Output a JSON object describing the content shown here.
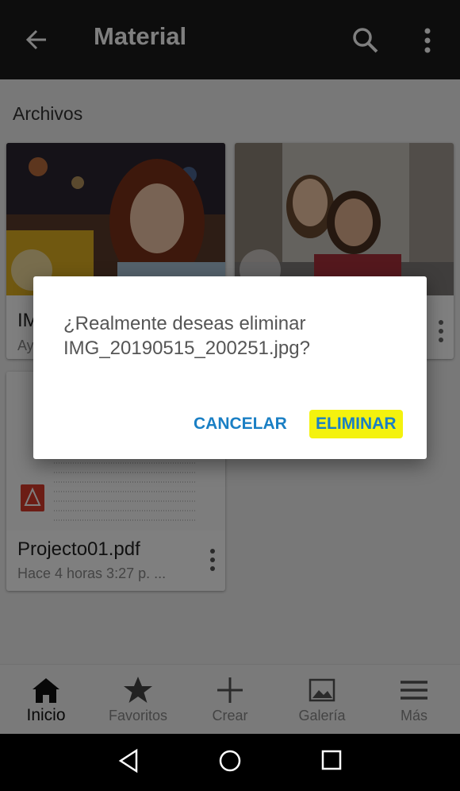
{
  "appbar": {
    "title": "Material",
    "back_icon": "arrow-left-icon",
    "search_icon": "search-icon",
    "more_icon": "more-vert-icon"
  },
  "section": {
    "title": "Archivos"
  },
  "files": [
    {
      "name": "IMG",
      "sub": "Ay"
    },
    {
      "name": "",
      "sub": ""
    },
    {
      "name": "Projecto01.pdf",
      "sub": "Hace 4 horas 3:27 p. ..."
    }
  ],
  "dialog": {
    "message": "¿Realmente deseas eliminar IMG_20190515_200251.jpg?",
    "cancel_label": "CANCELAR",
    "delete_label": "ELIMINAR"
  },
  "bottom_nav": [
    {
      "label": "Inicio",
      "icon": "home-icon",
      "active": true
    },
    {
      "label": "Favoritos",
      "icon": "star-icon"
    },
    {
      "label": "Crear",
      "icon": "plus-icon"
    },
    {
      "label": "Galería",
      "icon": "image-icon"
    },
    {
      "label": "Más",
      "icon": "menu-icon"
    }
  ],
  "system_nav": {
    "back_icon": "triangle-back-icon",
    "home_icon": "circle-home-icon",
    "recents_icon": "square-recents-icon"
  },
  "colors": {
    "accent": "#1a7fc4",
    "highlight": "#f4f20e",
    "appbar": "#1a1a1a"
  }
}
